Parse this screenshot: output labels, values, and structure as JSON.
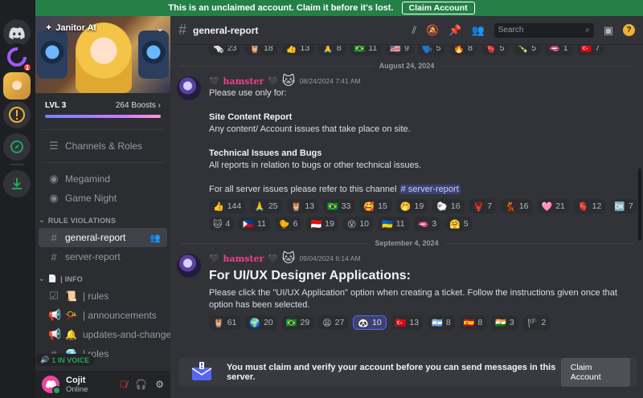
{
  "banner": {
    "text": "This is an unclaimed account. Claim it before it's lost.",
    "claim_label": "Claim Account"
  },
  "rail": {
    "badge_count": "1"
  },
  "server": {
    "name": "Janitor AI",
    "level": "LVL 3",
    "boosts": "264 Boosts",
    "boost_progress": 0.95
  },
  "sidebar": {
    "channels_roles": "Channels & Roles",
    "voice": [
      {
        "label": "Megamind"
      },
      {
        "label": "Game Night"
      }
    ],
    "cat_violations": "RULE VIOLATIONS",
    "violation_channels": [
      {
        "label": "general-report"
      },
      {
        "label": "server-report"
      }
    ],
    "cat_info": "| INFO",
    "info_channels": [
      {
        "label": "| rules"
      },
      {
        "label": "| announcements"
      },
      {
        "label": "updates-and-changes"
      },
      {
        "label": "| roles"
      }
    ],
    "in_voice": "1 IN VOICE"
  },
  "user": {
    "name": "Cojit",
    "status": "Online"
  },
  "header": {
    "channel": "general-report",
    "search_placeholder": "Search"
  },
  "top_reactions": [
    {
      "e": "🗞️",
      "n": "23"
    },
    {
      "e": "🦉",
      "n": "18"
    },
    {
      "e": "👍",
      "n": "13"
    },
    {
      "e": "🙏",
      "n": "8"
    },
    {
      "e": "🇧🇷",
      "n": "11"
    },
    {
      "e": "🇺🇸",
      "n": "9"
    },
    {
      "e": "🗣️",
      "n": "5"
    },
    {
      "e": "🔥",
      "n": "8"
    },
    {
      "e": "🫀",
      "n": "5"
    },
    {
      "e": "🍾",
      "n": "5"
    },
    {
      "e": "🫦",
      "n": "1"
    },
    {
      "e": "🇹🇷",
      "n": "7"
    }
  ],
  "messages": [
    {
      "date": "August 24, 2024",
      "author": "hamster",
      "time": "08/24/2024 7:41 AM",
      "intro": "Please use only for:",
      "s1_title": "Site Content Report",
      "s1_body": "Any content/ Account issues that take place on site.",
      "s2_title": "Technical Issues and Bugs",
      "s2_body": "All reports in relation to bugs or other technical issues.",
      "outro": "For all server issues please refer to this channel",
      "mention": "# server-report",
      "reactions": [
        {
          "e": "👍",
          "n": "144"
        },
        {
          "e": "🙏",
          "n": "25"
        },
        {
          "e": "🦉",
          "n": "13"
        },
        {
          "e": "🇧🇷",
          "n": "33"
        },
        {
          "e": "🥰",
          "n": "15"
        },
        {
          "e": "🤭",
          "n": "19"
        },
        {
          "e": "🐑",
          "n": "16"
        },
        {
          "e": "🦞",
          "n": "7"
        },
        {
          "e": "💃",
          "n": "16"
        },
        {
          "e": "🩷",
          "n": "21"
        },
        {
          "e": "🫀",
          "n": "12"
        },
        {
          "e": "🆗",
          "n": "7"
        },
        {
          "e": "🐱",
          "n": "4"
        },
        {
          "e": "🇵🇭",
          "n": "11"
        },
        {
          "e": "🐤",
          "n": "6"
        },
        {
          "e": "🇮🇩",
          "n": "19"
        },
        {
          "e": "😵",
          "n": "10"
        },
        {
          "e": "🇺🇦",
          "n": "11"
        },
        {
          "e": "🫦",
          "n": "3"
        },
        {
          "e": "🤗",
          "n": "5"
        }
      ]
    },
    {
      "date": "September 4, 2024",
      "author": "hamster",
      "time": "09/04/2024 6:14 AM",
      "title": "For UI/UX Designer Applications:",
      "body": "Please click the \"UI/UX Application\" option when creating a ticket. Follow the instructions given once that option has been selected.",
      "reactions": [
        {
          "e": "🦉",
          "n": "61"
        },
        {
          "e": "🌍",
          "n": "20"
        },
        {
          "e": "🇧🇷",
          "n": "29"
        },
        {
          "e": "😩",
          "n": "27"
        },
        {
          "e": "🐼",
          "n": "10",
          "mine": true
        },
        {
          "e": "🇹🇷",
          "n": "13"
        },
        {
          "e": "🇦🇷",
          "n": "8"
        },
        {
          "e": "🇪🇸",
          "n": "8"
        },
        {
          "e": "🇮🇳",
          "n": "3"
        },
        {
          "e": "🏴",
          "n": "2"
        }
      ]
    }
  ],
  "composer": {
    "text": "You must claim and verify your account before you can send messages in this server.",
    "button": "Claim Account"
  }
}
